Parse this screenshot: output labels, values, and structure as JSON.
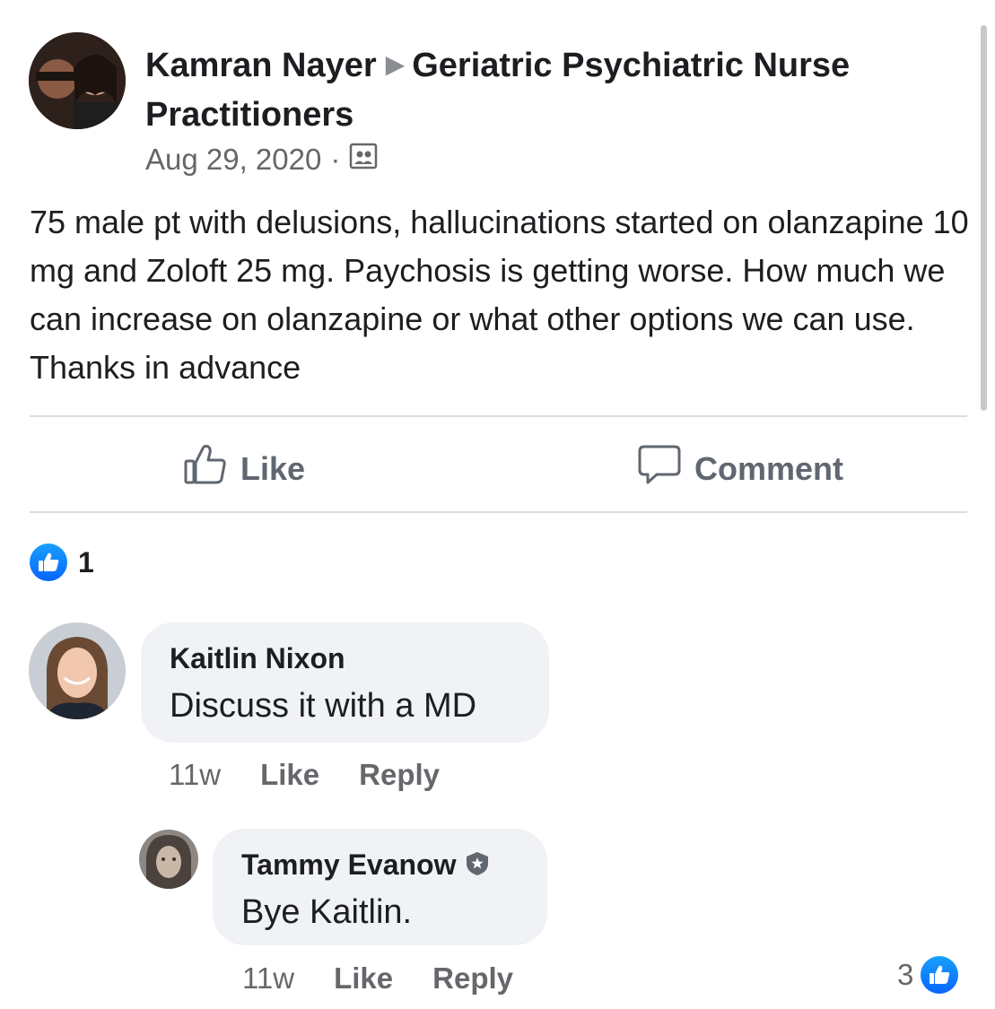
{
  "post": {
    "author": "Kamran Nayer",
    "group": "Geriatric Psychiatric Nurse Practitioners",
    "date": "Aug 29, 2020",
    "separator": "·",
    "audience_icon": "group-audience-icon",
    "body": "75 male pt with delusions, hallucinations started on olanzapine 10 mg and Zoloft 25 mg. Paychosis is getting worse. How much we can increase on olanzapine or what other options we can use. Thanks in advance"
  },
  "actions": {
    "like_label": "Like",
    "comment_label": "Comment"
  },
  "reactions": {
    "count": "1",
    "icon": "like-reaction-icon"
  },
  "comments": [
    {
      "name": "Kaitlin Nixon",
      "text": "Discuss it with a MD",
      "time": "11w",
      "like_label": "Like",
      "reply_label": "Reply"
    },
    {
      "name": "Tammy Evanow",
      "badge_icon": "admin-shield-icon",
      "text": "Bye Kaitlin.",
      "time": "11w",
      "like_label": "Like",
      "reply_label": "Reply",
      "reaction_count": "3"
    }
  ],
  "colors": {
    "like_blue": "#0866ff",
    "bubble_bg": "#f0f2f5",
    "secondary_text": "#65676b"
  }
}
